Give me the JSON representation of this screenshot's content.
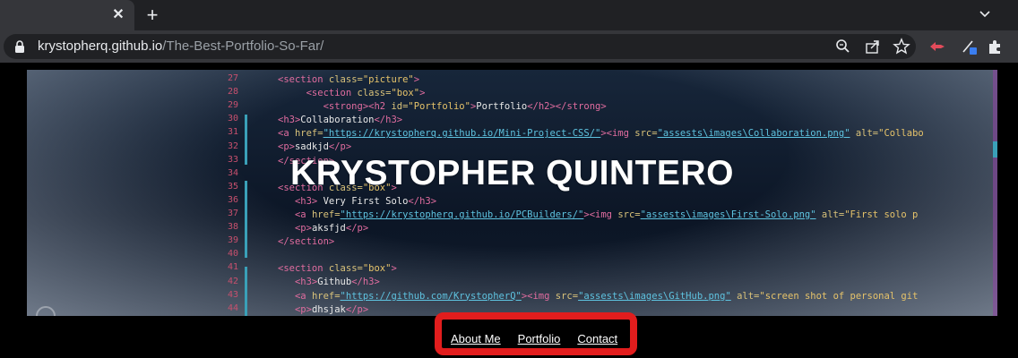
{
  "browser": {
    "tab_close": "✕",
    "new_tab": "+",
    "url_host": "krystopherq.github.io",
    "url_path": "/The-Best-Portfolio-So-Far/"
  },
  "page": {
    "title": "KRYSTOPHER QUINTERO",
    "nav": [
      {
        "label": "About Me"
      },
      {
        "label": "Portfolio"
      },
      {
        "label": "Contact"
      }
    ]
  },
  "code_lines": {
    "numbers": [
      "27",
      "28",
      "29",
      "30",
      "31",
      "32",
      "33",
      "34",
      "35",
      "36",
      "37",
      "38",
      "39",
      "40",
      "41",
      "42",
      "43",
      "44"
    ]
  },
  "colors": {
    "highlight": "#e21d1d",
    "chrome_dark": "#202124",
    "chrome_mid": "#35363a"
  }
}
